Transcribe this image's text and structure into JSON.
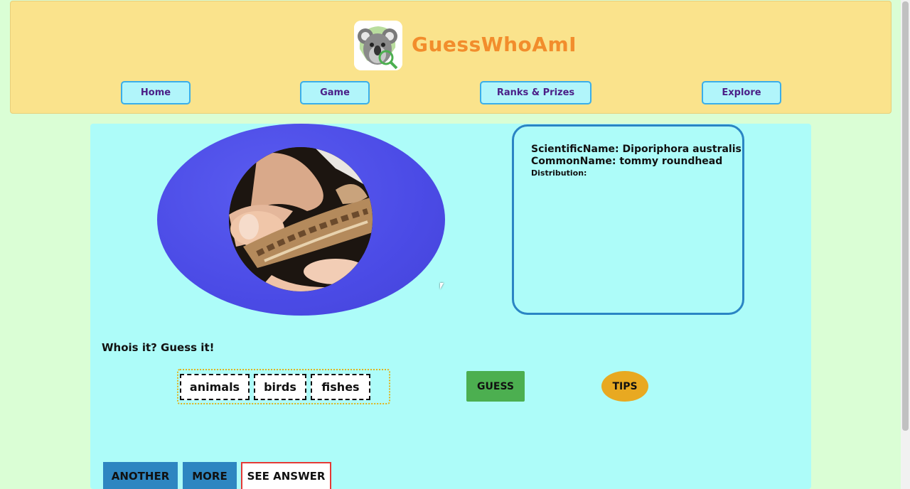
{
  "header": {
    "site_title": "GuessWhoAmI",
    "logo_icon": "koala-magnifier-logo"
  },
  "nav": {
    "items": [
      {
        "label": "Home"
      },
      {
        "label": "Game"
      },
      {
        "label": "Ranks & Prizes"
      },
      {
        "label": "Explore"
      }
    ]
  },
  "species": {
    "scientific_line": "ScientificName: Diporiphora australis",
    "common_line": "CommonName: tommy roundhead",
    "distribution_line": "Distribution:"
  },
  "game": {
    "question": "Whois it? Guess it!",
    "choices": [
      "animals",
      "birds",
      "fishes"
    ],
    "guess_label": "GUESS",
    "tips_label": "TIPS"
  },
  "actions": {
    "another_label": "ANOTHER",
    "more_label": "MORE",
    "see_answer_label": "SEE ANSWER"
  },
  "colors": {
    "page_bg": "#dafed5",
    "header_bg": "#fae38c",
    "title_orange": "#f28d2c",
    "main_bg": "#adfcf9",
    "guess_green": "#4caf50",
    "tips_orange": "#e8a921",
    "action_blue": "#2e86c1",
    "answer_red": "#e53935"
  }
}
